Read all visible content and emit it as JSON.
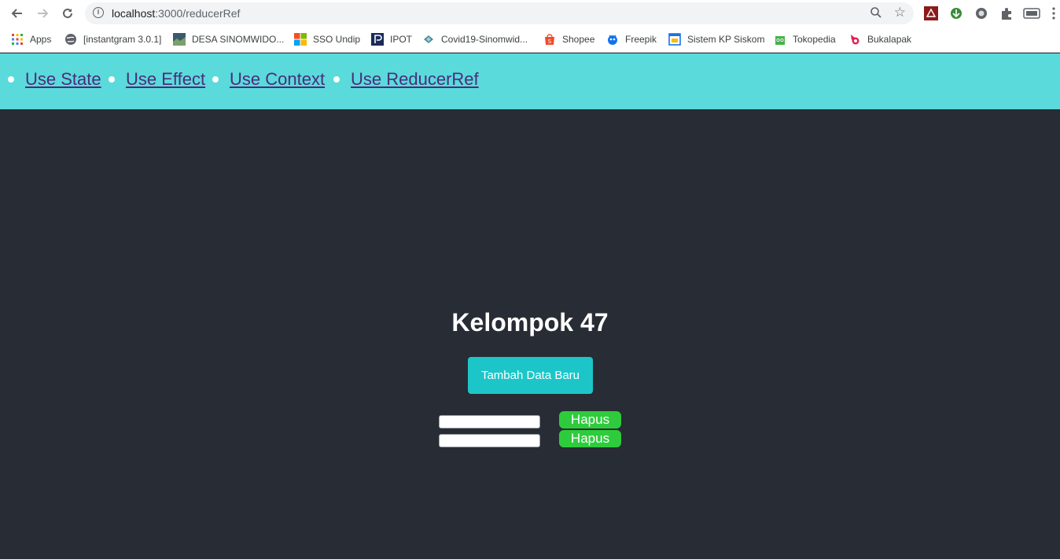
{
  "browser": {
    "url_host": "localhost",
    "url_path": ":3000/reducerRef"
  },
  "bookmarks": [
    {
      "label": "Apps",
      "icon": "apps-grid-icon"
    },
    {
      "label": "[instantgram 3.0.1]",
      "icon": "globe-icon"
    },
    {
      "label": "DESA SINOMWIDO...",
      "icon": "site-thumbnail-icon"
    },
    {
      "label": "SSO Undip",
      "icon": "windows-logo-icon"
    },
    {
      "label": "IPOT",
      "icon": "ipot-logo-icon"
    },
    {
      "label": "Covid19-Sinomwid...",
      "icon": "diamond-icon"
    },
    {
      "label": "Shopee",
      "icon": "shopee-bag-icon"
    },
    {
      "label": "Freepik",
      "icon": "freepik-logo-icon"
    },
    {
      "label": "Sistem KP Siskom",
      "icon": "window-icon"
    },
    {
      "label": "Tokopedia",
      "icon": "tokopedia-owl-icon"
    },
    {
      "label": "Bukalapak",
      "icon": "bukalapak-logo-icon"
    }
  ],
  "nav": {
    "items": [
      {
        "label": "Use State"
      },
      {
        "label": "Use Effect"
      },
      {
        "label": "Use Context"
      },
      {
        "label": "Use ReducerRef"
      }
    ]
  },
  "main": {
    "title": "Kelompok 47",
    "add_button": "Tambah Data Baru",
    "rows": [
      {
        "value": "",
        "delete_label": "Hapus"
      },
      {
        "value": "",
        "delete_label": "Hapus"
      }
    ]
  },
  "colors": {
    "header_bg": "#5bdadb",
    "page_bg": "#282c34",
    "add_button_bg": "#1cc6c8",
    "delete_button_bg": "#2ecc3c",
    "nav_link": "#4a2d7a"
  }
}
